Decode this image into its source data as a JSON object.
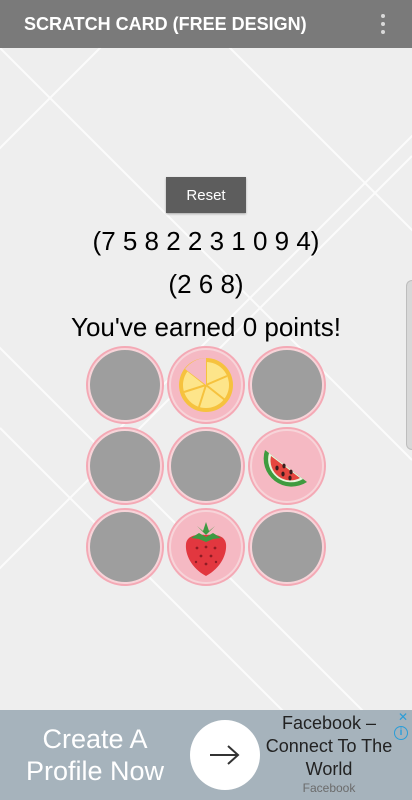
{
  "appbar": {
    "title": "SCRATCH CARD (FREE DESIGN)",
    "menu_icon": "overflow-menu-icon"
  },
  "game": {
    "reset_label": "Reset",
    "sequence_main": "(7 5 8 2 2 3 1 0 9 4)",
    "sequence_picked": "(2 6 8)",
    "points_text": "You've earned 0 points!",
    "cells": [
      {
        "state": "covered"
      },
      {
        "state": "revealed",
        "icon": "lemon-slice-icon"
      },
      {
        "state": "covered"
      },
      {
        "state": "covered"
      },
      {
        "state": "covered"
      },
      {
        "state": "revealed",
        "icon": "watermelon-slice-icon"
      },
      {
        "state": "covered"
      },
      {
        "state": "revealed",
        "icon": "strawberry-icon"
      },
      {
        "state": "covered"
      }
    ]
  },
  "ad": {
    "headline_line1": "Create A",
    "headline_line2": "Profile Now",
    "arrow_icon": "arrow-right-icon",
    "title": "Facebook – Connect To The World",
    "source": "Facebook",
    "info_icon": "info-icon",
    "close_icon": "close-icon"
  },
  "colors": {
    "appbar": "#7a7a7a",
    "reset_button": "#5d5d5d",
    "cell_ring": "#f4a9b5",
    "cell_cover": "#9e9e9e",
    "ad_background": "#a6b3bc"
  }
}
